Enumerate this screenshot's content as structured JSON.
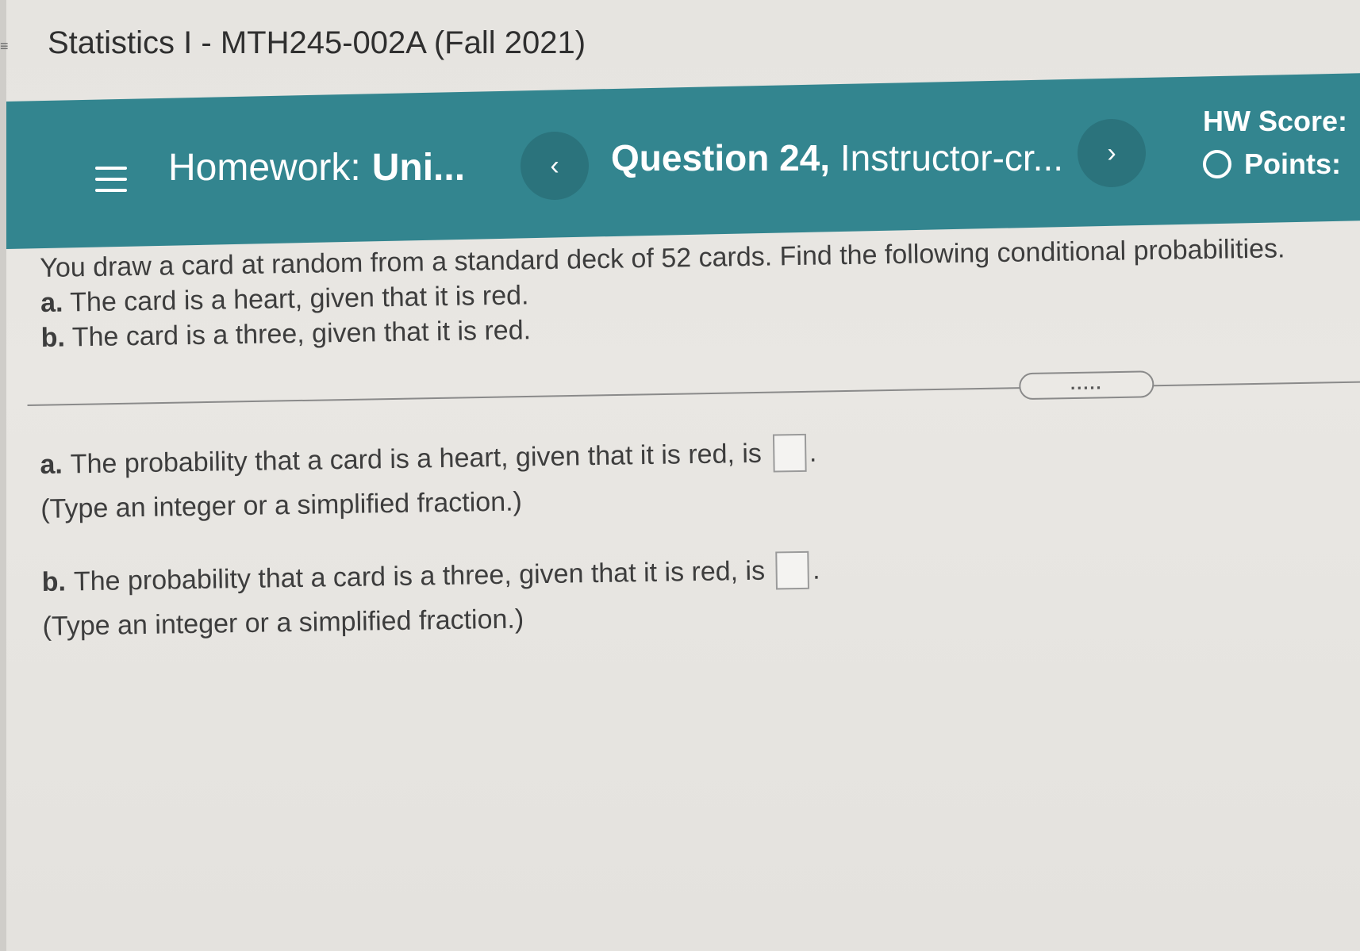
{
  "course": {
    "title": "Statistics I - MTH245-002A (Fall 2021)"
  },
  "nav": {
    "homework_prefix": "Homework:",
    "homework_name": "Uni...",
    "prev_symbol": "‹",
    "next_symbol": "›",
    "question_number": "Question 24,",
    "question_name": "Instructor-cr...",
    "hw_score_label": "HW Score:",
    "points_label": "Points:"
  },
  "problem": {
    "intro": "You draw a card at random from a standard deck of 52 cards. Find the following conditional probabilities.",
    "parts": [
      {
        "letter": "a.",
        "text": "The card is a heart, given that it is red."
      },
      {
        "letter": "b.",
        "text": "The card is a three, given that it is red."
      }
    ]
  },
  "divider": {
    "expand_label": "....."
  },
  "answers": [
    {
      "letter": "a.",
      "text": "The probability that a card is a heart, given that it is red, is",
      "value": "",
      "period": ".",
      "hint": "(Type an integer or a simplified fraction.)"
    },
    {
      "letter": "b.",
      "text": "The probability that a card is a three, given that it is red, is",
      "value": "",
      "period": ".",
      "hint": "(Type an integer or a simplified fraction.)"
    }
  ],
  "colors": {
    "nav_bar": "#33858f",
    "nav_button": "#2b737c",
    "background": "#e8e6e2",
    "text": "#3d3d3d"
  }
}
